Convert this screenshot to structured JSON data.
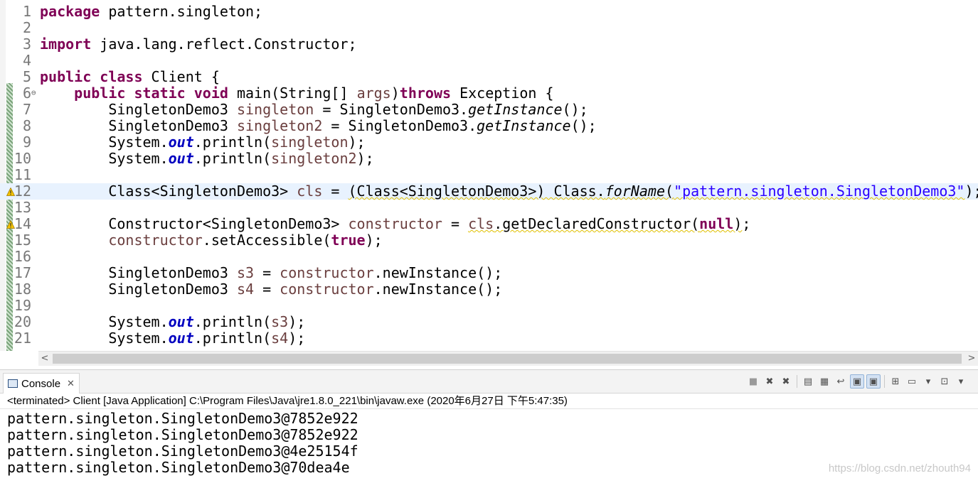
{
  "editor": {
    "lines": [
      {
        "n": "1",
        "tokens": [
          {
            "t": "package",
            "c": "kw"
          },
          {
            "t": " pattern.singleton;"
          }
        ]
      },
      {
        "n": "2",
        "tokens": []
      },
      {
        "n": "3",
        "tokens": [
          {
            "t": "import",
            "c": "kw"
          },
          {
            "t": " java.lang.reflect.Constructor;"
          }
        ]
      },
      {
        "n": "4",
        "tokens": []
      },
      {
        "n": "5",
        "tokens": [
          {
            "t": "public",
            "c": "kw"
          },
          {
            "t": " "
          },
          {
            "t": "class",
            "c": "kw"
          },
          {
            "t": " Client {"
          }
        ]
      },
      {
        "n": "6",
        "fold": "⊖",
        "tokens": [
          {
            "t": "    "
          },
          {
            "t": "public",
            "c": "kw"
          },
          {
            "t": " "
          },
          {
            "t": "static",
            "c": "kw"
          },
          {
            "t": " "
          },
          {
            "t": "void",
            "c": "kw"
          },
          {
            "t": " main(String[] "
          },
          {
            "t": "args",
            "c": "var"
          },
          {
            "t": ")"
          },
          {
            "t": "throws",
            "c": "kw"
          },
          {
            "t": " Exception {"
          }
        ]
      },
      {
        "n": "7",
        "tokens": [
          {
            "t": "        SingletonDemo3 "
          },
          {
            "t": "singleton",
            "c": "var"
          },
          {
            "t": " = SingletonDemo3."
          },
          {
            "t": "getInstance",
            "c": "sm"
          },
          {
            "t": "();"
          }
        ]
      },
      {
        "n": "8",
        "tokens": [
          {
            "t": "        SingletonDemo3 "
          },
          {
            "t": "singleton2",
            "c": "var"
          },
          {
            "t": " = SingletonDemo3."
          },
          {
            "t": "getInstance",
            "c": "sm"
          },
          {
            "t": "();"
          }
        ]
      },
      {
        "n": "9",
        "tokens": [
          {
            "t": "        System."
          },
          {
            "t": "out",
            "c": "fld"
          },
          {
            "t": ".println("
          },
          {
            "t": "singleton",
            "c": "var"
          },
          {
            "t": ");"
          }
        ]
      },
      {
        "n": "10",
        "tokens": [
          {
            "t": "        System."
          },
          {
            "t": "out",
            "c": "fld"
          },
          {
            "t": ".println("
          },
          {
            "t": "singleton2",
            "c": "var"
          },
          {
            "t": ");"
          }
        ]
      },
      {
        "n": "11",
        "tokens": []
      },
      {
        "n": "12",
        "current": true,
        "warn": true,
        "tokens": [
          {
            "t": "        Class<SingletonDemo3> "
          },
          {
            "t": "cls",
            "c": "var"
          },
          {
            "t": " = "
          },
          {
            "t": "(Class<SingletonDemo3>) Class.",
            "c": "squig"
          },
          {
            "t": "forName",
            "c": "sm squig"
          },
          {
            "t": "(",
            "c": "squig"
          },
          {
            "t": "\"pattern.singleton.SingletonDemo3\"",
            "c": "str squig"
          },
          {
            "t": ");"
          }
        ]
      },
      {
        "n": "13",
        "tokens": []
      },
      {
        "n": "14",
        "warn": true,
        "tokens": [
          {
            "t": "        Constructor<SingletonDemo3> "
          },
          {
            "t": "constructor",
            "c": "var"
          },
          {
            "t": " = "
          },
          {
            "t": "cls",
            "c": "var squig"
          },
          {
            "t": ".getDeclaredConstructor(",
            "c": "squig"
          },
          {
            "t": "null",
            "c": "kw squig"
          },
          {
            "t": ")",
            "c": "squig"
          },
          {
            "t": ";"
          }
        ]
      },
      {
        "n": "15",
        "tokens": [
          {
            "t": "        "
          },
          {
            "t": "constructor",
            "c": "var"
          },
          {
            "t": ".setAccessible("
          },
          {
            "t": "true",
            "c": "kw"
          },
          {
            "t": ");"
          }
        ]
      },
      {
        "n": "16",
        "tokens": []
      },
      {
        "n": "17",
        "tokens": [
          {
            "t": "        SingletonDemo3 "
          },
          {
            "t": "s3",
            "c": "var"
          },
          {
            "t": " = "
          },
          {
            "t": "constructor",
            "c": "var"
          },
          {
            "t": ".newInstance();"
          }
        ]
      },
      {
        "n": "18",
        "tokens": [
          {
            "t": "        SingletonDemo3 "
          },
          {
            "t": "s4",
            "c": "var"
          },
          {
            "t": " = "
          },
          {
            "t": "constructor",
            "c": "var"
          },
          {
            "t": ".newInstance();"
          }
        ]
      },
      {
        "n": "19",
        "tokens": []
      },
      {
        "n": "20",
        "tokens": [
          {
            "t": "        System."
          },
          {
            "t": "out",
            "c": "fld"
          },
          {
            "t": ".println("
          },
          {
            "t": "s3",
            "c": "var"
          },
          {
            "t": ");"
          }
        ]
      },
      {
        "n": "21",
        "tokens": [
          {
            "t": "        System."
          },
          {
            "t": "out",
            "c": "fld"
          },
          {
            "t": ".println("
          },
          {
            "t": "s4",
            "c": "var"
          },
          {
            "t": ");"
          }
        ]
      }
    ]
  },
  "scrollbar": {
    "left_arrow": "<",
    "right_arrow": ">"
  },
  "console": {
    "tab_label": "Console",
    "tab_close": "✕",
    "status": "<terminated> Client [Java Application] C:\\Program Files\\Java\\jre1.8.0_221\\bin\\javaw.exe (2020年6月27日 下午5:47:35)",
    "output": [
      "pattern.singleton.SingletonDemo3@7852e922",
      "pattern.singleton.SingletonDemo3@7852e922",
      "pattern.singleton.SingletonDemo3@4e25154f",
      "pattern.singleton.SingletonDemo3@70dea4e"
    ],
    "toolbar": [
      {
        "name": "terminate-icon",
        "glyph": "■"
      },
      {
        "name": "remove-launch-icon",
        "glyph": "✖"
      },
      {
        "name": "remove-all-terminated-icon",
        "glyph": "✖"
      },
      {
        "sep": true
      },
      {
        "name": "clear-console-icon",
        "glyph": "▤"
      },
      {
        "name": "scroll-lock-icon",
        "glyph": "▦"
      },
      {
        "name": "word-wrap-icon",
        "glyph": "↩"
      },
      {
        "name": "show-on-stdout-icon",
        "glyph": "▣",
        "pressed": true
      },
      {
        "name": "show-on-stderr-icon",
        "glyph": "▣",
        "pressed": true
      },
      {
        "sep": true
      },
      {
        "name": "pin-console-icon",
        "glyph": "⊞"
      },
      {
        "name": "display-selected-console-icon",
        "glyph": "▭"
      },
      {
        "name": "display-dropdown-icon",
        "glyph": "▾"
      },
      {
        "name": "open-console-icon",
        "glyph": "⊡"
      },
      {
        "name": "open-console-dropdown-icon",
        "glyph": "▾"
      }
    ]
  },
  "watermark": "https://blog.csdn.net/zhouth94"
}
